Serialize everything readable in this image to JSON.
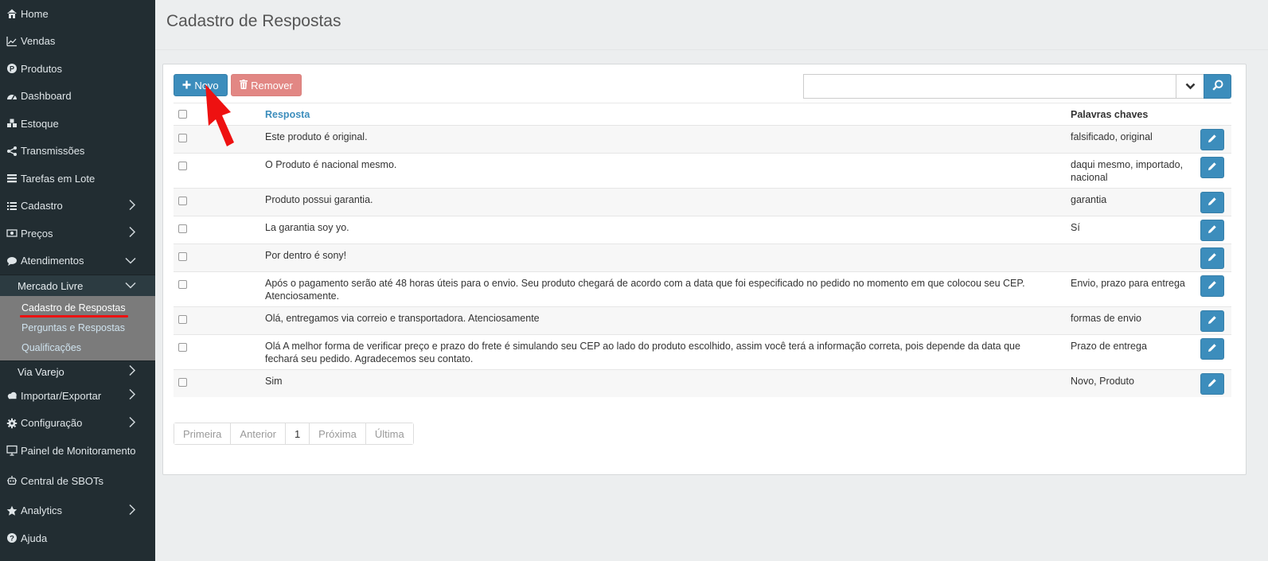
{
  "sidebar": {
    "items": [
      {
        "label": "Home",
        "icon": "home-icon",
        "has_children": false
      },
      {
        "label": "Vendas",
        "icon": "line-chart-icon",
        "has_children": false
      },
      {
        "label": "Produtos",
        "icon": "product-icon",
        "has_children": false
      },
      {
        "label": "Dashboard",
        "icon": "dashboard-icon",
        "has_children": false
      },
      {
        "label": "Estoque",
        "icon": "cubes-icon",
        "has_children": false
      },
      {
        "label": "Transmissões",
        "icon": "share-icon",
        "has_children": false
      },
      {
        "label": "Tarefas em Lote",
        "icon": "tasks-icon",
        "has_children": false
      },
      {
        "label": "Cadastro",
        "icon": "list-icon",
        "has_children": true
      },
      {
        "label": "Preços",
        "icon": "money-icon",
        "has_children": true
      },
      {
        "label": "Atendimentos",
        "icon": "chat-icon",
        "has_children": true,
        "expanded": true
      }
    ],
    "atendimentos": {
      "mercado_livre": {
        "label": "Mercado Livre",
        "children": [
          "Cadastro de Respostas",
          "Perguntas e Respostas",
          "Qualificações"
        ],
        "active": "Cadastro de Respostas"
      },
      "via_varejo": {
        "label": "Via Varejo"
      }
    },
    "items_after": [
      {
        "label": "Importar/Exportar",
        "icon": "cloud-icon",
        "has_children": true
      },
      {
        "label": "Configuração",
        "icon": "gear-icon",
        "has_children": true
      },
      {
        "label": "Painel de Monitoramento",
        "icon": "monitor-icon",
        "has_children": false
      },
      {
        "label": "Central de SBOTs",
        "icon": "robot-icon",
        "has_children": false
      },
      {
        "label": "Analytics",
        "icon": "star-icon",
        "has_children": true
      },
      {
        "label": "Ajuda",
        "icon": "question-icon",
        "has_children": false
      }
    ]
  },
  "page": {
    "title": "Cadastro de Respostas"
  },
  "toolbar": {
    "novo_label": "Novo",
    "remover_label": "Remover",
    "search_value": ""
  },
  "table": {
    "headers": {
      "resposta": "Resposta",
      "palavras": "Palavras chaves"
    },
    "rows": [
      {
        "resposta": "Este produto é original.",
        "palavras": "falsificado, original"
      },
      {
        "resposta": "O Produto é nacional mesmo.",
        "palavras": "daqui mesmo, importado, nacional"
      },
      {
        "resposta": "Produto possui garantia.",
        "palavras": "garantia"
      },
      {
        "resposta": "La garantia soy yo.",
        "palavras": "Sí"
      },
      {
        "resposta": "Por dentro é sony!",
        "palavras": ""
      },
      {
        "resposta": "Após o pagamento serão até 48 horas úteis para o envio. Seu produto chegará de acordo com a data que foi especificado no pedido no momento em que colocou seu CEP. Atenciosamente.",
        "palavras": "Envio, prazo para entrega"
      },
      {
        "resposta": "Olá, entregamos via correio e transportadora. Atenciosamente",
        "palavras": "formas de envio"
      },
      {
        "resposta": "Olá A melhor forma de verificar preço e prazo do frete é simulando seu CEP ao lado do produto escolhido, assim você terá a informação correta, pois depende da data que fechará seu pedido. Agradecemos seu contato.",
        "palavras": "Prazo de entrega"
      },
      {
        "resposta": "Sim",
        "palavras": "Novo, Produto"
      }
    ]
  },
  "pagination": {
    "first": "Primeira",
    "prev": "Anterior",
    "current": "1",
    "next": "Próxima",
    "last": "Última"
  },
  "colors": {
    "sidebar_bg": "#222d32",
    "primary": "#3c8dbc",
    "danger_muted": "#e28784",
    "highlight_underline": "#ee1111",
    "annotation_arrow": "#ee1111"
  }
}
